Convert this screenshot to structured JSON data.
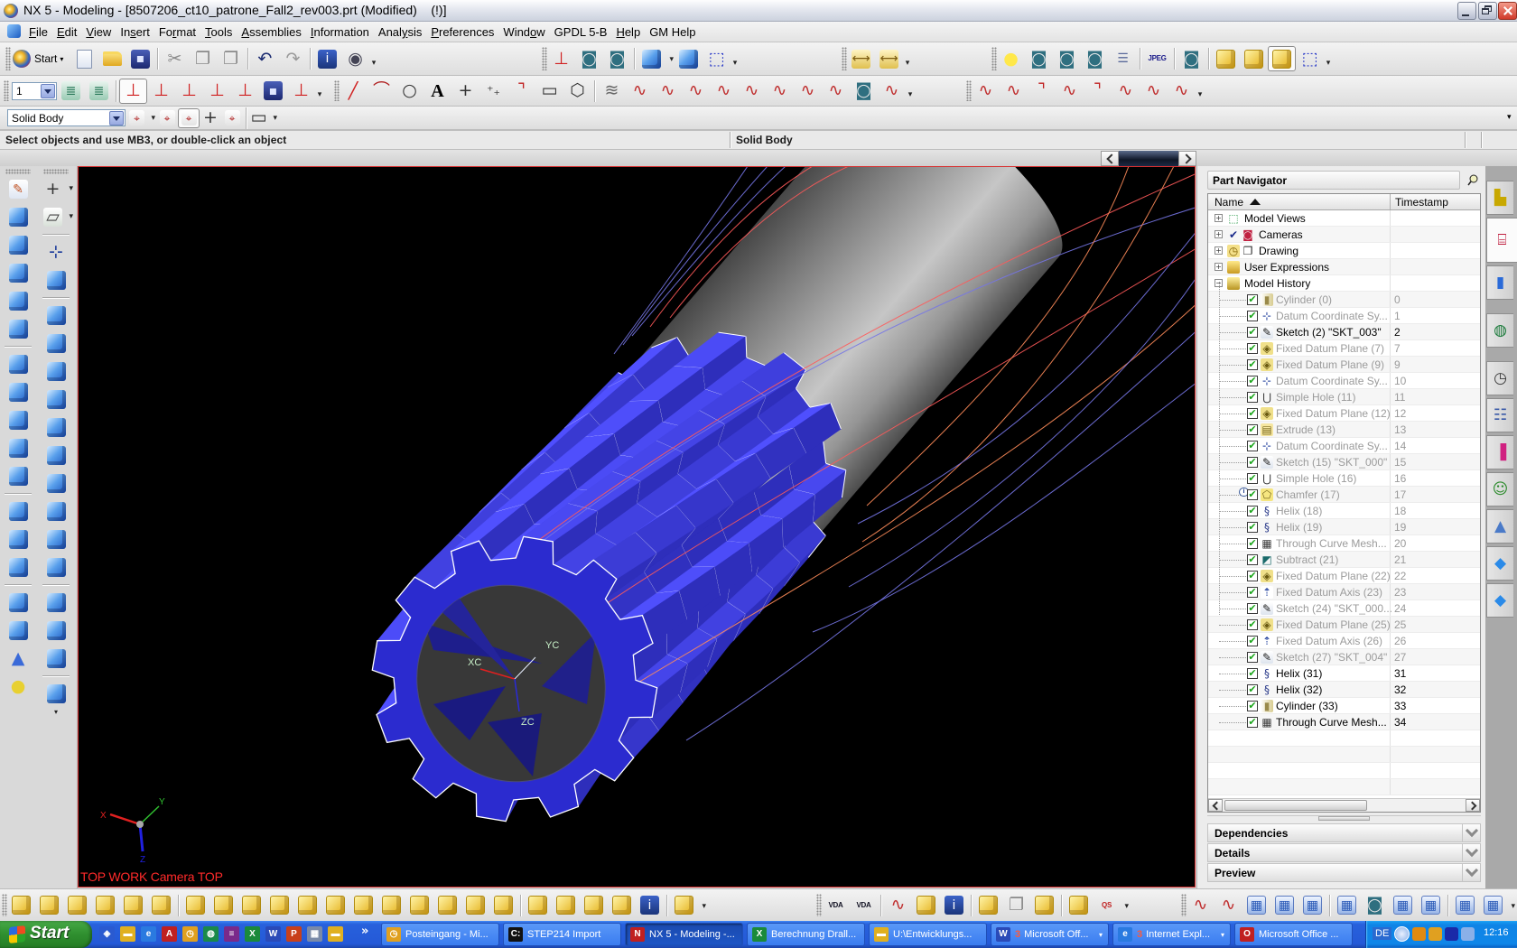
{
  "window": {
    "title": "NX 5 - Modeling - [8507206_ct10_patrone_Fall2_rev003.prt (Modified)    (!)]"
  },
  "menu": [
    {
      "label": "File",
      "accel": 0
    },
    {
      "label": "Edit",
      "accel": 0
    },
    {
      "label": "View",
      "accel": 0
    },
    {
      "label": "Insert",
      "accel": 2
    },
    {
      "label": "Format",
      "accel": 2
    },
    {
      "label": "Tools",
      "accel": 0
    },
    {
      "label": "Assemblies",
      "accel": 0
    },
    {
      "label": "Information",
      "accel": 0
    },
    {
      "label": "Analysis",
      "accel": 4
    },
    {
      "label": "Preferences",
      "accel": 0
    },
    {
      "label": "Window",
      "accel": 4
    },
    {
      "label": "GPDL 5-B",
      "accel": -1
    },
    {
      "label": "Help",
      "accel": 0
    },
    {
      "label": "GM Help",
      "accel": -1
    }
  ],
  "toolbars": {
    "standard": {
      "start_label": "Start",
      "items": [
        "new-file",
        "open-file",
        "save",
        "sep",
        "cut",
        "copy",
        "paste",
        "sep",
        "undo",
        "redo",
        "sep",
        "information",
        "show-hide",
        "drop"
      ]
    },
    "view": [
      "wcs-orient-view",
      "orient-view-to-model",
      "replace-view",
      "sep",
      {
        "icon": "shaded-with-edges",
        "drop": true
      },
      "shaded",
      "static-wireframe",
      "drop"
    ],
    "analysis": [
      "measure-distance",
      "measure-angle",
      "drop"
    ],
    "visualization": [
      "lightbulb",
      "high-quality-image",
      "view-section",
      "capture-image",
      "list-objects",
      "sep",
      "jpeg-export",
      "sep",
      "studio-display",
      "sep",
      "add-existing-component",
      "reposition-component",
      {
        "icon": "make-work-part",
        "pressed": true
      },
      "wireframe-block",
      "drop"
    ],
    "utility": {
      "layer_value": "1",
      "items": [
        "layer-settings",
        "move-to-layer",
        "sep",
        {
          "icon": "wcs-dynamics",
          "pressed": true
        },
        "wcs-origin",
        "wcs-rotate",
        "wcs-orient",
        "wcs-set-origin-xyz",
        "wcs-save",
        "wcs-display",
        "drop"
      ]
    },
    "curve": [
      "line",
      "arc",
      "circle",
      "text",
      "point",
      "point-set",
      "corner-fillet",
      "rectangle",
      "polygon",
      "sep",
      "helix",
      "law-curve",
      "offset-curve",
      "offset-in-face",
      "bridge-curve",
      "project-curve",
      "combined-projection",
      "extract-curve",
      "wrap-curve",
      "intersection-curve",
      "isoparametric-curve",
      "drop"
    ],
    "edit_curve": [
      "edit-curve-parameters",
      "trim-curve",
      "trim-corner",
      "divide-curve",
      "edit-fillet",
      "edit-curve-length",
      "smooth-spline",
      "curve-stretch",
      "drop"
    ],
    "selection": {
      "filter_value": "Solid Body",
      "items": [
        {
          "icon": "type-filter",
          "drop": true
        },
        "reset-filter",
        {
          "icon": "select-faces",
          "pressed": true
        },
        "snap-point",
        "snap-feature",
        "sep",
        {
          "icon": "rectangle-select",
          "drop": true
        }
      ]
    },
    "feature_left": [
      "sketch",
      "extrude",
      "revolve",
      "variational-sweep",
      "sweep-along-guide",
      "tube",
      "sep",
      "hole",
      "boss",
      "pocket",
      "pad",
      "groove",
      "sep",
      "offset-face",
      "draft",
      "face-patch",
      "sep",
      "block",
      "cylinder",
      "cone",
      "sphere"
    ],
    "feature_right": [
      {
        "icon": "datum-point",
        "drop": true
      },
      {
        "icon": "datum-plane",
        "drop": true
      },
      "sep",
      "datum-csys",
      "trim-body",
      "sep",
      "edge-blend",
      "face-blend",
      "soft-blend",
      "shell",
      "slot",
      "thread",
      "instance-feature",
      "unite",
      "hole-pattern",
      "emboss",
      "sep",
      "split-body",
      "thicken",
      "patch-body",
      "sep",
      "pattern-face",
      "drop"
    ],
    "assemblies": [
      "find-component",
      "open-by-proximity",
      "show-product-outline",
      "assembly-constraints-display",
      "assembly-sequence",
      "exploded-views",
      "sep",
      "add-existing-component",
      "create-new-component",
      "create-new-parent",
      "mate-component",
      "mirror-assembly",
      "reposition-component",
      "replace-component",
      "create-component-array",
      "substitute-component",
      "wave-geometry-linker",
      "reference-set",
      "remove-component",
      "sep",
      "clearance-analysis",
      "component-properties",
      "link-assembly",
      "check-assembly",
      "component-info",
      "sep",
      {
        "icon": "verify-assembly",
        "drop": true
      }
    ],
    "vda": [
      "vda-checker",
      "vda-add-check",
      "sep",
      "paint-geometry",
      "check-geometry",
      "information-window",
      "sep",
      "gm-tool-cat",
      "copy-files",
      "drawing-edit",
      "sep",
      "frame-check",
      {
        "icon": "qs-stamp",
        "drop": true
      }
    ],
    "freeform": [
      "through-curves",
      "through-curve-mesh",
      "studio-surface",
      "swept",
      "ruled-surface",
      "sep",
      "n-sided-surface",
      "sweep-section",
      "extension-surface",
      "law-extension",
      "sep",
      "offset-surface",
      {
        "icon": "trim-sheet",
        "drop": true
      }
    ]
  },
  "status": {
    "prompt": "Select objects and use MB3, or double-click an object",
    "selection_info": "Solid Body"
  },
  "viewport": {
    "view_label": "TOP WORK Camera TOP",
    "triad_labels": {
      "x": "X",
      "y": "Y",
      "z": "Z"
    },
    "wcs_labels": {
      "xc": "XC",
      "yc": "YC",
      "zc": "ZC"
    },
    "colors": {
      "background": "#000000",
      "border": "#d83030",
      "front_face": "#2b2bcf",
      "bore": "#383838",
      "curve_red": "#ff5a5a",
      "curve_orange": "#ff8c5a",
      "curve_blue": "#7676e6",
      "label": "#ff2a2a",
      "wcs_label": "#c8f0c8"
    }
  },
  "part_navigator": {
    "title": "Part Navigator",
    "columns": {
      "name": "Name",
      "timestamp": "Timestamp"
    },
    "sort": "ascending",
    "nodes": [
      {
        "label": "Model Views",
        "icon": "model-views",
        "expander": "+"
      },
      {
        "label": "Cameras",
        "icon": "cameras",
        "expander": "+",
        "checkmark": true
      },
      {
        "label": "Drawing",
        "icon": "drawing",
        "expander": "+"
      },
      {
        "label": "User Expressions",
        "icon": "user-expressions",
        "expander": "+"
      },
      {
        "label": "Model History",
        "icon": "model-history",
        "expander": "-"
      }
    ],
    "history": [
      {
        "label": "Cylinder (0)",
        "ts": "0",
        "icon": "cylinder",
        "active": false
      },
      {
        "label": "Datum Coordinate Sy...",
        "ts": "1",
        "icon": "datum-csys",
        "active": false
      },
      {
        "label": "Sketch (2) \"SKT_003\"",
        "ts": "2",
        "icon": "sketch",
        "active": true
      },
      {
        "label": "Fixed Datum Plane (7)",
        "ts": "7",
        "icon": "datum-plane",
        "active": false
      },
      {
        "label": "Fixed Datum Plane (9)",
        "ts": "9",
        "icon": "datum-plane",
        "active": false
      },
      {
        "label": "Datum Coordinate Sy...",
        "ts": "10",
        "icon": "datum-csys",
        "active": false
      },
      {
        "label": "Simple Hole (11)",
        "ts": "11",
        "icon": "simple-hole",
        "active": false
      },
      {
        "label": "Fixed Datum Plane (12)",
        "ts": "12",
        "icon": "datum-plane",
        "active": false
      },
      {
        "label": "Extrude (13)",
        "ts": "13",
        "icon": "extrude",
        "active": false
      },
      {
        "label": "Datum Coordinate Sy...",
        "ts": "14",
        "icon": "datum-csys",
        "active": false
      },
      {
        "label": "Sketch (15) \"SKT_000\"",
        "ts": "15",
        "icon": "sketch",
        "active": false
      },
      {
        "label": "Simple Hole (16)",
        "ts": "16",
        "icon": "simple-hole",
        "active": false
      },
      {
        "label": "Chamfer (17)",
        "ts": "17",
        "icon": "chamfer",
        "active": false,
        "info": true
      },
      {
        "label": "Helix (18)",
        "ts": "18",
        "icon": "helix",
        "active": false
      },
      {
        "label": "Helix (19)",
        "ts": "19",
        "icon": "helix",
        "active": false
      },
      {
        "label": "Through Curve Mesh...",
        "ts": "20",
        "icon": "through-curve-mesh",
        "active": false
      },
      {
        "label": "Subtract (21)",
        "ts": "21",
        "icon": "subtract",
        "active": false
      },
      {
        "label": "Fixed Datum Plane (22)",
        "ts": "22",
        "icon": "datum-plane",
        "active": false
      },
      {
        "label": "Fixed Datum Axis (23)",
        "ts": "23",
        "icon": "datum-axis",
        "active": false
      },
      {
        "label": "Sketch (24) \"SKT_000...",
        "ts": "24",
        "icon": "sketch",
        "active": false
      },
      {
        "label": "Fixed Datum Plane (25)",
        "ts": "25",
        "icon": "datum-plane",
        "active": false
      },
      {
        "label": "Fixed Datum Axis (26)",
        "ts": "26",
        "icon": "datum-axis",
        "active": false
      },
      {
        "label": "Sketch (27) \"SKT_004\"",
        "ts": "27",
        "icon": "sketch",
        "active": false
      },
      {
        "label": "Helix (31)",
        "ts": "31",
        "icon": "helix",
        "active": true
      },
      {
        "label": "Helix (32)",
        "ts": "32",
        "icon": "helix",
        "active": true
      },
      {
        "label": "Cylinder (33)",
        "ts": "33",
        "icon": "cylinder",
        "active": true
      },
      {
        "label": "Through Curve Mesh...",
        "ts": "34",
        "icon": "through-curve-mesh",
        "active": true
      }
    ],
    "panels": [
      "Dependencies",
      "Details",
      "Preview"
    ]
  },
  "resource_bar": [
    {
      "icon": "assembly-navigator"
    },
    {
      "icon": "part-navigator",
      "selected": true
    },
    {
      "icon": "reuse-library"
    },
    "sep",
    {
      "icon": "web-browser"
    },
    "sep",
    {
      "icon": "history-palette"
    },
    {
      "icon": "system-materials"
    },
    {
      "icon": "visualization-palette"
    },
    {
      "icon": "roles"
    },
    {
      "icon": "system-scenes"
    },
    {
      "icon": "process-studio"
    },
    {
      "icon": "manufacturing-wizards"
    }
  ],
  "taskbar": {
    "start_label": "Start",
    "quick_launch": [
      "show-desktop",
      "explorer",
      "internet-explorer",
      "acrobat",
      "outlook",
      "web-globe",
      "winrar",
      "excel",
      "word",
      "powerpoint",
      "calculator",
      "folder"
    ],
    "tasks": [
      {
        "label": "Posteingang - Mi...",
        "icon": "outlook"
      },
      {
        "label": "STEP214 Import",
        "icon": "command-prompt"
      },
      {
        "label": "NX 5 - Modeling -...",
        "icon": "nx",
        "active": true
      },
      {
        "label": "Berechnung Drall...",
        "icon": "excel"
      },
      {
        "label": "U:\\Entwicklungs...",
        "icon": "folder"
      },
      {
        "label": "Microsoft Off...",
        "count": "3",
        "icon": "word",
        "grouped": true
      },
      {
        "label": "Internet Expl...",
        "count": "3",
        "icon": "internet-explorer",
        "grouped": true
      },
      {
        "label": "Microsoft Office ...",
        "icon": "office"
      }
    ],
    "tray": {
      "language": "DE",
      "icons": [
        "app-tray",
        "outlook-reminder",
        "network-status",
        "search"
      ],
      "time": "12:16"
    }
  }
}
